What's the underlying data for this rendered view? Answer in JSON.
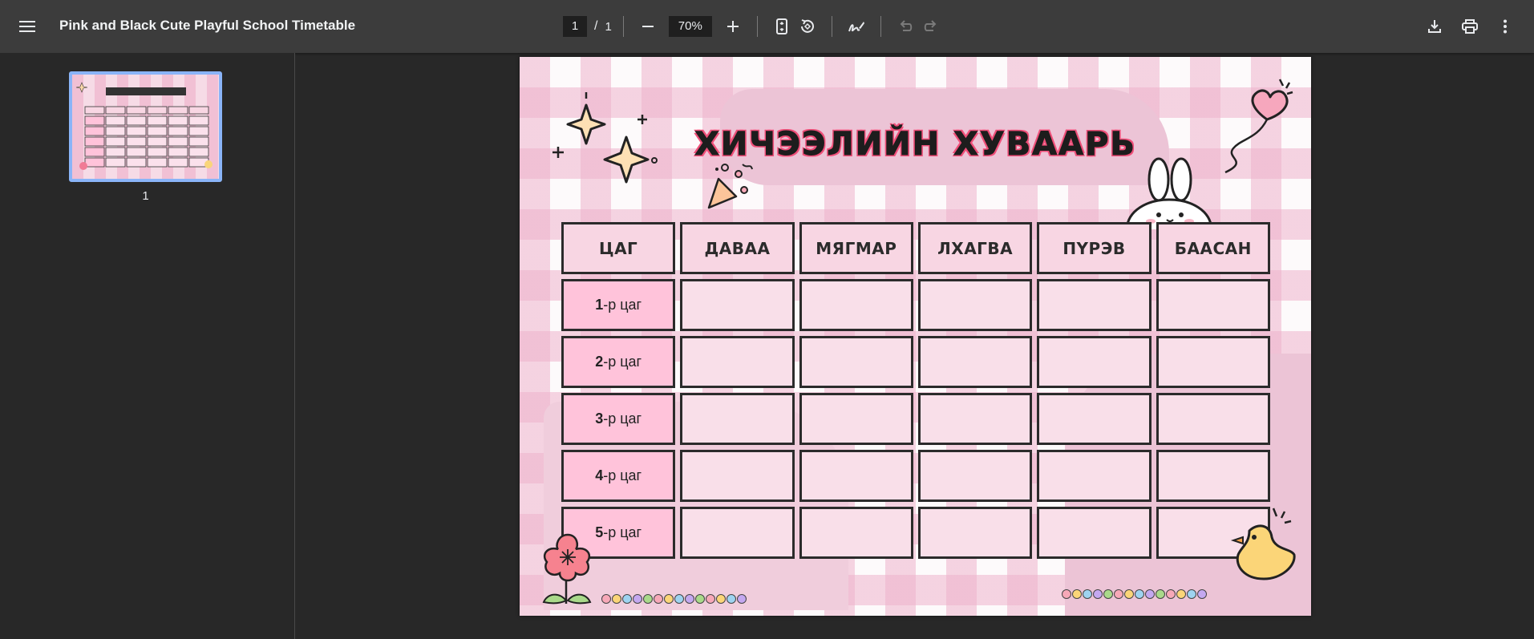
{
  "toolbar": {
    "title": "Pink and Black Cute Playful School Timetable",
    "current_page": "1",
    "page_separator": "/",
    "total_pages": "1",
    "zoom": "70%"
  },
  "sidebar": {
    "thumbnail_page_number": "1"
  },
  "document": {
    "title": "ХИЧЭЭЛИЙН ХУВААРЬ",
    "headers": [
      "ЦАГ",
      "ДАВАА",
      "МЯГМАР",
      "ЛХАГВА",
      "ПҮРЭВ",
      "БААСАН"
    ],
    "periods": [
      {
        "num": "1",
        "suffix": "-р цаг"
      },
      {
        "num": "2",
        "suffix": "-р цаг"
      },
      {
        "num": "3",
        "suffix": "-р цаг"
      },
      {
        "num": "4",
        "suffix": "-р цаг"
      },
      {
        "num": "5",
        "suffix": "-р цаг"
      }
    ]
  },
  "colors": {
    "toolbar_bg": "#3c3c3c",
    "viewer_bg": "#282828",
    "accent_pink": "#ef4f79",
    "cell_pink": "#f9dfe9",
    "period_pink": "#ffc3da",
    "thumb_border": "#8ab4f8"
  },
  "icons": {
    "menu": "hamburger-menu-icon",
    "zoom_out": "minus-icon",
    "zoom_in": "plus-icon",
    "fit": "fit-to-page-icon",
    "rotate": "rotate-icon",
    "annotate": "pen-icon",
    "undo": "undo-icon",
    "redo": "redo-icon",
    "download": "download-icon",
    "print": "print-icon",
    "more": "more-vert-icon"
  }
}
